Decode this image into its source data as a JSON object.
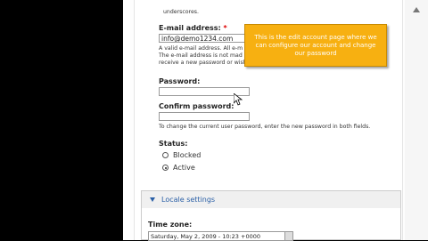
{
  "intro": {
    "underscores_text": "underscores."
  },
  "email": {
    "label": "E-mail address:",
    "required_marker": "*",
    "value": "info@demo1234.com",
    "description_line1": "A valid e-mail address. All e-m",
    "description_line2": "The e-mail address is not mad",
    "description_line3": "receive a new password or wish"
  },
  "tooltip": {
    "text": "This is the edit account page where we can configure our account and change our password"
  },
  "password": {
    "label": "Password:",
    "value": ""
  },
  "confirm_password": {
    "label": "Confirm password:",
    "value": "",
    "description": "To change the current user password, enter the new password in both fields."
  },
  "status": {
    "label": "Status:",
    "options": [
      {
        "label": "Blocked",
        "selected": false
      },
      {
        "label": "Active",
        "selected": true
      }
    ]
  },
  "locale": {
    "toggle_label": "Locale settings",
    "time_zone_label": "Time zone:",
    "time_zone_value": "Saturday, May 2, 2009 - 10:23 +0000"
  },
  "icons": {
    "scroll_up": "scroll-arrow-icon",
    "cursor": "mouse-pointer-icon",
    "radio": "radio-button-icon",
    "collapse": "collapse-triangle-icon",
    "dropdown": "dropdown-arrow-icon"
  },
  "colors": {
    "tooltip_bg": "#f7b011",
    "link": "#2a5fa6",
    "required": "#dd0000"
  }
}
